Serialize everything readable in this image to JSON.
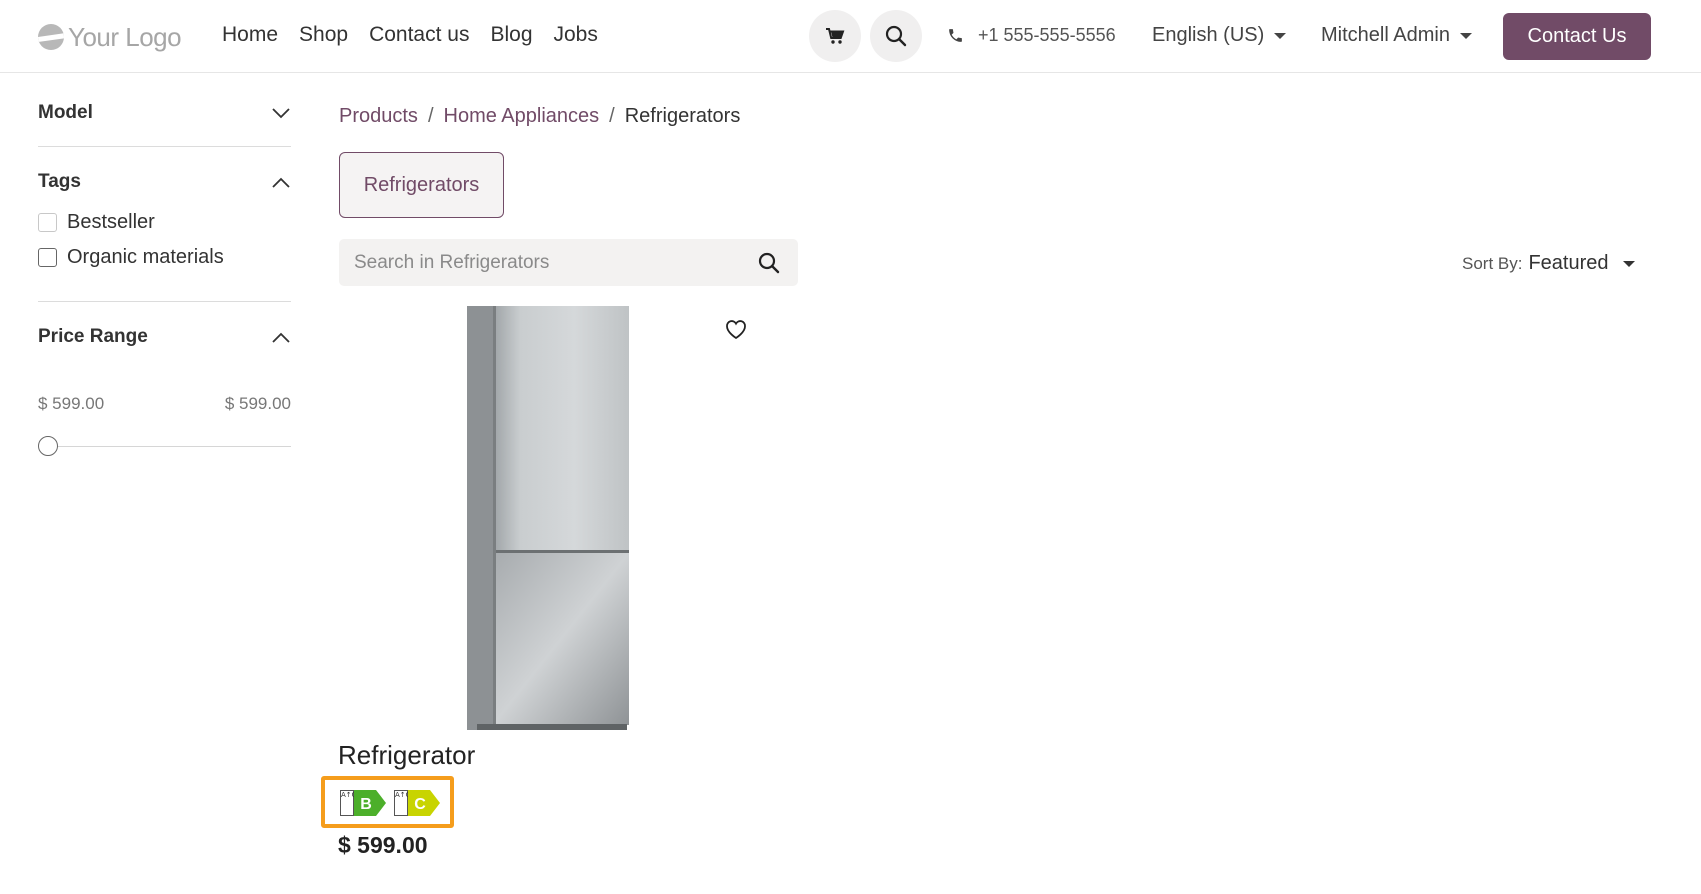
{
  "header": {
    "logo_text": "Your Logo",
    "nav": [
      "Home",
      "Shop",
      "Contact us",
      "Blog",
      "Jobs"
    ],
    "cart_icon": "cart-icon",
    "search_icon": "search-icon",
    "phone": "+1 555-555-5556",
    "language": "English (US)",
    "user": "Mitchell Admin",
    "contact_button": "Contact Us",
    "accent": "#714b67"
  },
  "sidebar": {
    "model": {
      "title": "Model"
    },
    "tags": {
      "title": "Tags",
      "items": [
        {
          "label": "Bestseller",
          "checked": false
        },
        {
          "label": "Organic materials",
          "checked": false
        }
      ]
    },
    "price_range": {
      "title": "Price Range",
      "min": "$ 599.00",
      "max": "$ 599.00"
    }
  },
  "main": {
    "breadcrumb": [
      "Products",
      "Home Appliances",
      "Refrigerators"
    ],
    "category_button": "Refrigerators",
    "search_placeholder": "Search in Refrigerators",
    "sort_label": "Sort By:",
    "sort_value": "Featured",
    "product": {
      "name": "Refrigerator",
      "price": "$ 599.00",
      "energy_labels": [
        {
          "class": "B",
          "color": "#4caf2a",
          "scale": "A↑G"
        },
        {
          "class": "C",
          "color": "#c8d400",
          "scale": "A↑G"
        }
      ],
      "highlight_color": "#f59d1c"
    }
  }
}
